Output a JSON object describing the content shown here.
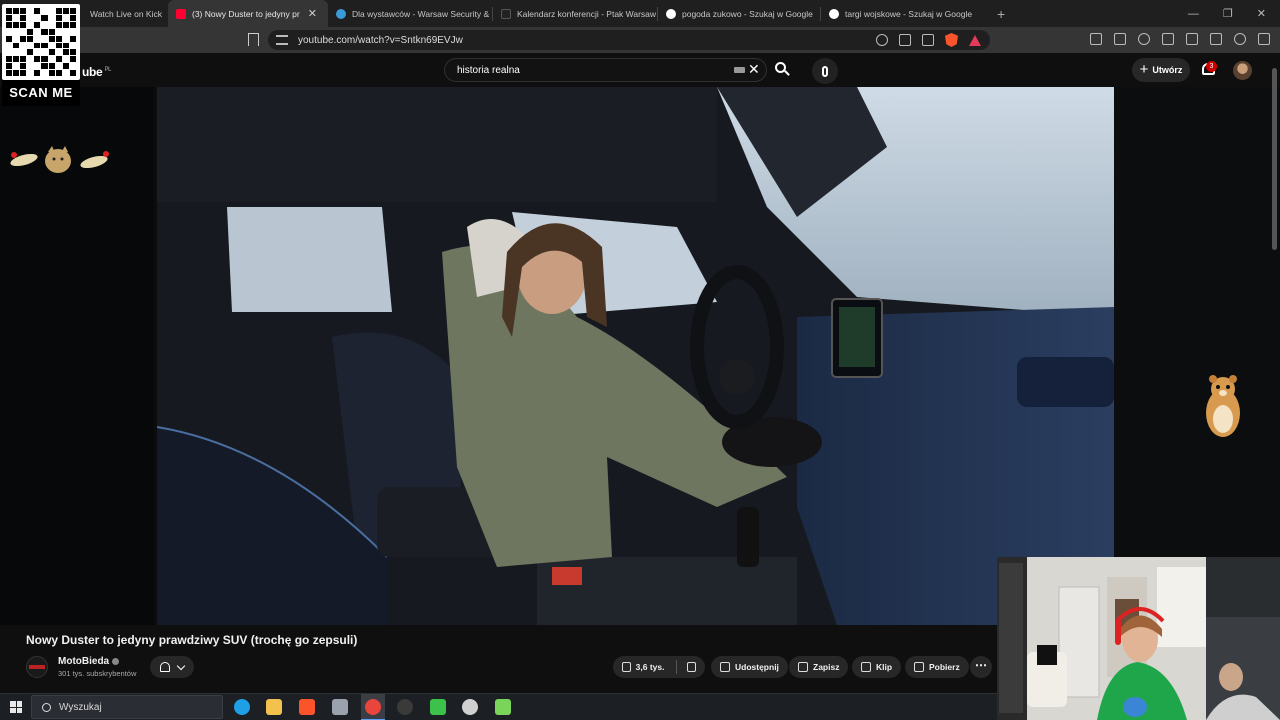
{
  "browser": {
    "tabs": [
      {
        "title": "Watch Live on Kick",
        "favicon_color": "#53fc18"
      },
      {
        "title": "(3) Nowy Duster to jedyny pr",
        "favicon_color": "#ff0033",
        "active": true
      },
      {
        "title": "Dla wystawców - Warsaw Security &",
        "favicon_color": "#3a9bd9"
      },
      {
        "title": "Kalendarz konferencji - Ptak Warsaw",
        "favicon_color": "#222222"
      },
      {
        "title": "pogoda zukowo - Szukaj w Google",
        "favicon_color": "#ffffff"
      },
      {
        "title": "targi wojskowe - Szukaj w Google",
        "favicon_color": "#ffffff"
      }
    ],
    "tab_close_glyph": "✕",
    "new_tab_glyph": "+",
    "window_controls": [
      "—",
      "❐",
      "✕"
    ],
    "url": "youtube.com/watch?v=Sntkn69EVJw"
  },
  "youtube": {
    "logo_text": "ube",
    "logo_region": "PL",
    "search_query": "historia realna",
    "clear_glyph": "✕",
    "create_label": "Utwórz",
    "create_glyph": "+",
    "notification_count": "3",
    "accent": "#ff0033"
  },
  "overlay": {
    "scan_label": "SCAN ME"
  },
  "video": {
    "title": "Nowy Duster to jedyny prawdziwy SUV (trochę go zepsuli)",
    "channel_name": "MotoBieda",
    "subscribers": "301 tys. subskrybentów",
    "likes": "3,6 tys.",
    "actions": {
      "share": "Udostępnij",
      "save": "Zapisz",
      "clip": "Klip",
      "download": "Pobierz"
    },
    "more_glyph": "⋯"
  },
  "taskbar": {
    "search_placeholder": "Wyszukaj",
    "apps": [
      {
        "name": "edge-icon",
        "color": "#1fa0e6"
      },
      {
        "name": "file-explorer-icon",
        "color": "#f2c14e"
      },
      {
        "name": "brave-icon",
        "color": "#fb542b"
      },
      {
        "name": "app-icon",
        "color": "#9aa3ad"
      },
      {
        "name": "chrome-icon",
        "color": "#e8453c"
      },
      {
        "name": "obs-icon",
        "color": "#3a3a3a"
      },
      {
        "name": "streaming-icon",
        "color": "#3cc24a"
      },
      {
        "name": "settings-icon",
        "color": "#d0d0d0"
      },
      {
        "name": "app-tool-icon",
        "color": "#7bd45a"
      }
    ]
  }
}
